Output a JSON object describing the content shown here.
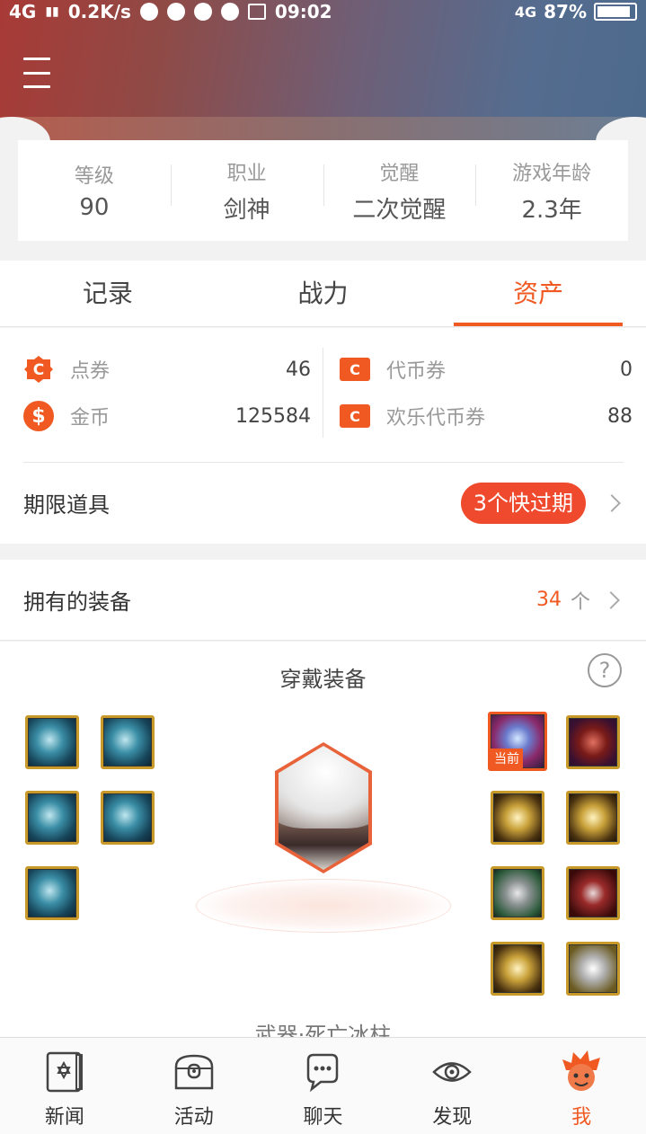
{
  "status_bar": {
    "network": "4G",
    "speed": "0.2K/s",
    "time": "09:02",
    "signal_right": "4G",
    "battery": "87%"
  },
  "profile": {
    "stats": [
      {
        "label": "等级",
        "value": "90"
      },
      {
        "label": "职业",
        "value": "剑神"
      },
      {
        "label": "觉醒",
        "value": "二次觉醒"
      },
      {
        "label": "游戏年龄",
        "value": "2.3年"
      }
    ]
  },
  "tabs": [
    {
      "label": "记录",
      "active": false
    },
    {
      "label": "战力",
      "active": false
    },
    {
      "label": "资产",
      "active": true
    }
  ],
  "assets": {
    "left": [
      {
        "icon": "point-coupon-icon",
        "name": "点券",
        "value": "46"
      },
      {
        "icon": "gold-coin-icon",
        "name": "金币",
        "value": "125584"
      }
    ],
    "right": [
      {
        "icon": "token-voucher-icon",
        "name": "代币券",
        "value": "0"
      },
      {
        "icon": "happy-token-voucher-icon",
        "name": "欢乐代币券",
        "value": "88"
      }
    ],
    "limited_items": {
      "title": "期限道具",
      "badge": "3个快过期"
    }
  },
  "owned_equipment": {
    "title": "拥有的装备",
    "count": "34",
    "unit": "个"
  },
  "wear": {
    "title": "穿戴装备",
    "help": "?",
    "current_tag": "当前",
    "weapon_label": "武器·死亡冰柱"
  },
  "bottom_nav": [
    {
      "icon": "news-book-icon",
      "label": "新闻",
      "active": false
    },
    {
      "icon": "activity-chest-icon",
      "label": "活动",
      "active": false
    },
    {
      "icon": "chat-bubble-icon",
      "label": "聊天",
      "active": false
    },
    {
      "icon": "discover-eye-icon",
      "label": "发现",
      "active": false
    },
    {
      "icon": "me-avatar-icon",
      "label": "我",
      "active": true
    }
  ],
  "colors": {
    "accent": "#f05a22",
    "badge": "#f04a2e",
    "header_start": "#a83a36",
    "header_end": "#4c6a8c"
  }
}
